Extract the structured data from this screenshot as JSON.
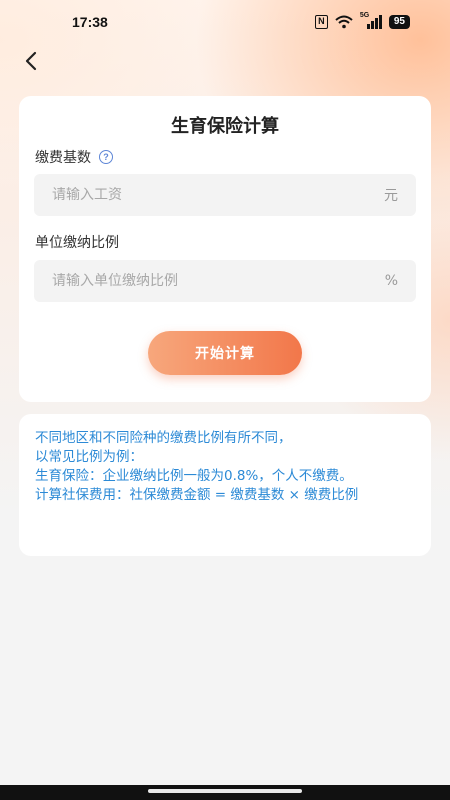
{
  "status_bar": {
    "time": "17:38",
    "network_label": "5G",
    "battery": "95"
  },
  "nav": {
    "back_icon": "chevron-left-icon"
  },
  "calculator": {
    "title": "生育保险计算",
    "base_field": {
      "label": "缴费基数",
      "placeholder": "请输入工资",
      "value": "",
      "unit": "元"
    },
    "ratio_field": {
      "label": "单位缴纳比例",
      "placeholder": "请输入单位缴纳比例",
      "value": "",
      "unit": "%"
    },
    "calculate_label": "开始计算"
  },
  "info": {
    "lines": [
      "不同地区和不同险种的缴费比例有所不同，",
      "以常见比例为例：",
      "生育保险：企业缴纳比例一般为0.8%，个人不缴费。",
      "计算社保费用：社保缴费金额 = 缴费基数 × 缴费比例"
    ]
  },
  "colors": {
    "accent_start": "#f7a77c",
    "accent_end": "#f2774a",
    "info_text": "#2c8ad6",
    "help_icon": "#5e86d6"
  }
}
